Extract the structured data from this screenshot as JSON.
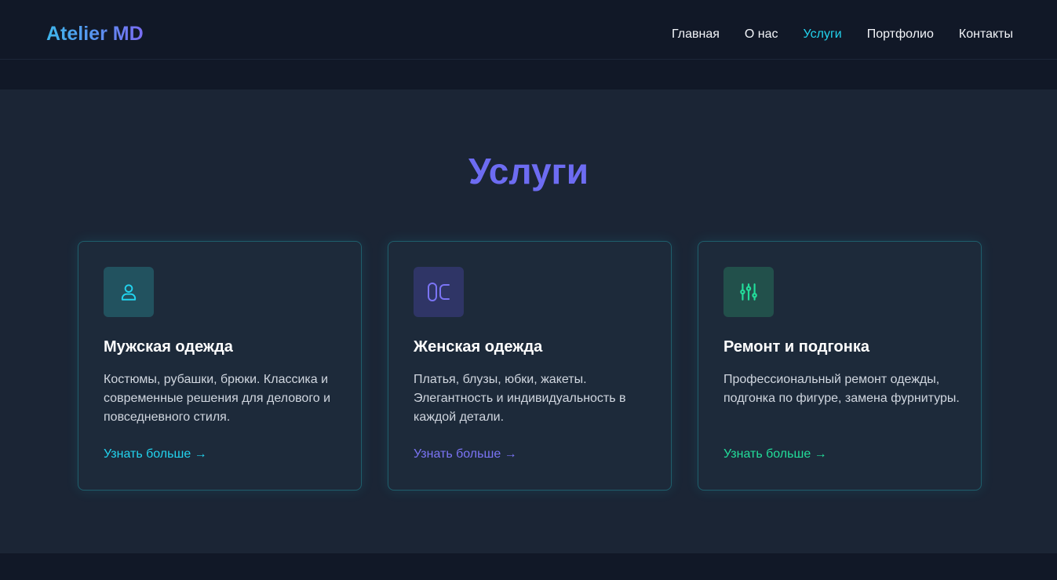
{
  "header": {
    "logo": "Atelier MD",
    "nav": [
      {
        "label": "Главная",
        "active": false
      },
      {
        "label": "О нас",
        "active": false
      },
      {
        "label": "Услуги",
        "active": true
      },
      {
        "label": "Портфолио",
        "active": false
      },
      {
        "label": "Контакты",
        "active": false
      }
    ]
  },
  "services": {
    "title": "Услуги",
    "cards": [
      {
        "icon": "user-icon",
        "title": "Мужская одежда",
        "text": "Костюмы, рубашки, брюки. Классика и современные решения для делового и повседневного стиля.",
        "link": "Узнать больше →",
        "accent": "#22d3ee"
      },
      {
        "icon": "scissors-icon",
        "title": "Женская одежда",
        "text": "Платья, блузы, юбки, жакеты. Элегантность и индивидуальность в каждой детали.",
        "link": "Узнать больше →",
        "accent": "#7b74f5"
      },
      {
        "icon": "adjustments-icon",
        "title": "Ремонт и подгонка",
        "text": "Профессиональный ремонт одежды, подгонка по фигуре, замена фурнитуры.",
        "link": "Узнать больше →",
        "accent": "#22dd9a"
      }
    ]
  },
  "colors": {
    "background": "#1b2535",
    "header_background": "#111827",
    "title": "#6d6cf2",
    "nav_active": "#22d3ee"
  }
}
